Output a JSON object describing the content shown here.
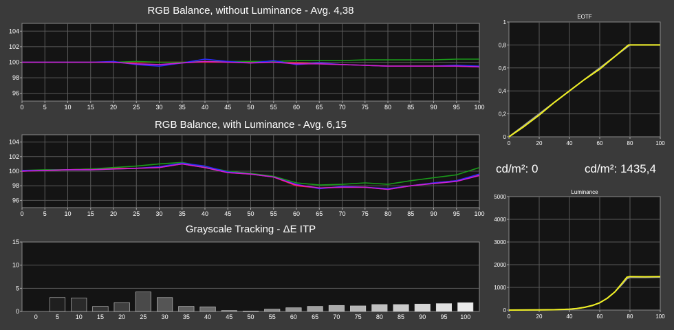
{
  "chart_data": [
    {
      "id": "rgb_no_lum",
      "type": "line",
      "title": "RGB Balance, without Luminance - Avg. 4,38",
      "xlim": [
        0,
        100
      ],
      "ylim": [
        95,
        105
      ],
      "x_ticks": [
        0,
        5,
        10,
        15,
        20,
        25,
        30,
        35,
        40,
        45,
        50,
        55,
        60,
        65,
        70,
        75,
        80,
        85,
        90,
        95,
        100
      ],
      "y_ticks": [
        96,
        98,
        100,
        102,
        104
      ],
      "x": [
        0,
        5,
        10,
        15,
        20,
        25,
        30,
        35,
        40,
        45,
        50,
        55,
        60,
        65,
        70,
        75,
        80,
        85,
        90,
        95,
        100
      ],
      "series": [
        {
          "color": "#ff2020",
          "values": [
            100,
            100,
            100,
            100,
            100,
            100,
            100,
            100,
            100,
            100,
            100,
            100,
            99.9,
            99.8,
            99.7,
            99.6,
            99.5,
            99.5,
            99.5,
            99.5,
            99.4
          ]
        },
        {
          "color": "#1a9a1a",
          "values": [
            100,
            100,
            100,
            100,
            100,
            100.1,
            100,
            100,
            100.1,
            100.1,
            100.1,
            100.1,
            100.2,
            100.2,
            100.2,
            100.3,
            100.3,
            100.3,
            100.3,
            100.4,
            100.4
          ]
        },
        {
          "color": "#2a2aff",
          "values": [
            100,
            100,
            100,
            100,
            100.1,
            99.7,
            99.5,
            99.9,
            100.4,
            100.1,
            99.9,
            100.2,
            99.7,
            99.9,
            99.7,
            99.6,
            99.5,
            99.5,
            99.5,
            99.6,
            99.5
          ]
        },
        {
          "color": "#d020d0",
          "values": [
            100,
            100,
            100,
            100,
            100,
            99.8,
            99.7,
            99.9,
            100.1,
            100,
            99.9,
            100,
            99.8,
            99.8,
            99.7,
            99.6,
            99.5,
            99.5,
            99.5,
            99.5,
            99.4
          ]
        }
      ]
    },
    {
      "id": "rgb_lum",
      "type": "line",
      "title": "RGB Balance, with Luminance - Avg. 6,15",
      "xlim": [
        0,
        100
      ],
      "ylim": [
        95,
        105
      ],
      "x_ticks": [
        0,
        5,
        10,
        15,
        20,
        25,
        30,
        35,
        40,
        45,
        50,
        55,
        60,
        65,
        70,
        75,
        80,
        85,
        90,
        95,
        100
      ],
      "y_ticks": [
        96,
        98,
        100,
        102,
        104
      ],
      "x": [
        0,
        5,
        10,
        15,
        20,
        25,
        30,
        35,
        40,
        45,
        50,
        55,
        60,
        65,
        70,
        75,
        80,
        85,
        90,
        95,
        100
      ],
      "series": [
        {
          "color": "#ff2020",
          "values": [
            100,
            100.1,
            100.2,
            100.3,
            100.4,
            100.4,
            100.5,
            101,
            100.5,
            99.8,
            99.6,
            99.2,
            98,
            97.7,
            97.8,
            97.8,
            97.5,
            98,
            98.4,
            98.7,
            99.5
          ]
        },
        {
          "color": "#1a9a1a",
          "values": [
            100.1,
            100.2,
            100.2,
            100.3,
            100.5,
            100.7,
            101,
            101.2,
            100.6,
            100,
            99.7,
            99.3,
            98.4,
            98.1,
            98.2,
            98.4,
            98.2,
            98.7,
            99.1,
            99.5,
            100.5
          ]
        },
        {
          "color": "#2a2aff",
          "values": [
            100.1,
            100.1,
            100.2,
            100.2,
            100.3,
            100.4,
            100.6,
            101.1,
            100.7,
            99.9,
            99.6,
            99.2,
            98.2,
            97.6,
            97.9,
            97.8,
            97.6,
            98,
            98.4,
            98.7,
            99.6
          ]
        },
        {
          "color": "#d020d0",
          "values": [
            100,
            100.1,
            100.2,
            100.2,
            100.3,
            100.4,
            100.5,
            101,
            100.5,
            99.8,
            99.6,
            99.2,
            98.1,
            97.7,
            97.8,
            97.8,
            97.5,
            98,
            98.3,
            98.6,
            99.4
          ]
        }
      ]
    },
    {
      "id": "grayscale",
      "type": "bar",
      "title": "Grayscale Tracking - ΔE ITP",
      "ylim": [
        0,
        15
      ],
      "y_ticks": [
        0,
        5,
        10,
        15
      ],
      "categories": [
        "0",
        "5",
        "10",
        "15",
        "20",
        "25",
        "30",
        "35",
        "40",
        "45",
        "50",
        "55",
        "60",
        "65",
        "70",
        "75",
        "80",
        "85",
        "90",
        "95",
        "100"
      ],
      "values": [
        0,
        3,
        2.9,
        1.1,
        1.9,
        4.2,
        3,
        1.1,
        1,
        0.2,
        0.1,
        0.5,
        0.8,
        1.1,
        1.3,
        1.2,
        1.5,
        1.5,
        1.6,
        1.7,
        1.9
      ]
    },
    {
      "id": "eotf",
      "type": "line",
      "title": "EOTF",
      "xlim": [
        0,
        100
      ],
      "ylim": [
        0,
        1
      ],
      "x_ticks": [
        0,
        20,
        40,
        60,
        80,
        100
      ],
      "x_tick_labels": [
        "0",
        "20",
        "40",
        "60",
        "80",
        "100"
      ],
      "y_ticks": [
        0,
        0.2,
        0.4,
        0.6,
        0.8,
        1
      ],
      "y_tick_labels": [
        "0",
        "0,2",
        "0,4",
        "0,6",
        "0,8",
        "1"
      ],
      "series": [
        {
          "name": "",
          "color": "#9a9a9a",
          "x": [
            0,
            10,
            20,
            30,
            40,
            50,
            60,
            70,
            78,
            80,
            90,
            100
          ],
          "values": [
            0,
            0.1,
            0.2,
            0.3,
            0.4,
            0.5,
            0.6,
            0.7,
            0.78,
            0.8,
            0.8,
            0.8
          ]
        },
        {
          "name": "",
          "color": "#f0f020",
          "x": [
            0,
            10,
            20,
            30,
            40,
            50,
            60,
            70,
            79,
            81,
            90,
            100
          ],
          "values": [
            0,
            0.09,
            0.19,
            0.3,
            0.4,
            0.5,
            0.59,
            0.7,
            0.8,
            0.8,
            0.8,
            0.8
          ]
        }
      ]
    },
    {
      "id": "luminance",
      "type": "line",
      "title": "Luminance",
      "xlim": [
        0,
        100
      ],
      "ylim": [
        0,
        5000
      ],
      "x_ticks": [
        0,
        20,
        40,
        60,
        80,
        100
      ],
      "x_tick_labels": [
        "0",
        "20",
        "40",
        "60",
        "80",
        "100"
      ],
      "y_ticks": [
        0,
        1000,
        2000,
        3000,
        4000,
        5000
      ],
      "y_tick_labels": [
        "0",
        "1000",
        "2000",
        "3000",
        "4000",
        "5000"
      ],
      "series": [
        {
          "name": "",
          "color": "#9a9a9a",
          "x": [
            0,
            20,
            30,
            40,
            45,
            50,
            55,
            60,
            65,
            70,
            75,
            78,
            80,
            90,
            100
          ],
          "values": [
            0,
            5,
            15,
            40,
            70,
            120,
            200,
            320,
            520,
            800,
            1150,
            1380,
            1440,
            1440,
            1450
          ]
        },
        {
          "name": "",
          "color": "#f0f020",
          "x": [
            0,
            20,
            30,
            40,
            45,
            50,
            55,
            60,
            65,
            70,
            75,
            78,
            80,
            90,
            100
          ],
          "values": [
            0,
            5,
            15,
            40,
            70,
            120,
            200,
            320,
            520,
            800,
            1200,
            1450,
            1480,
            1470,
            1480
          ]
        }
      ]
    }
  ],
  "readouts": {
    "black": "cd/m²: 0",
    "peak": "cd/m²: 1435,4"
  }
}
